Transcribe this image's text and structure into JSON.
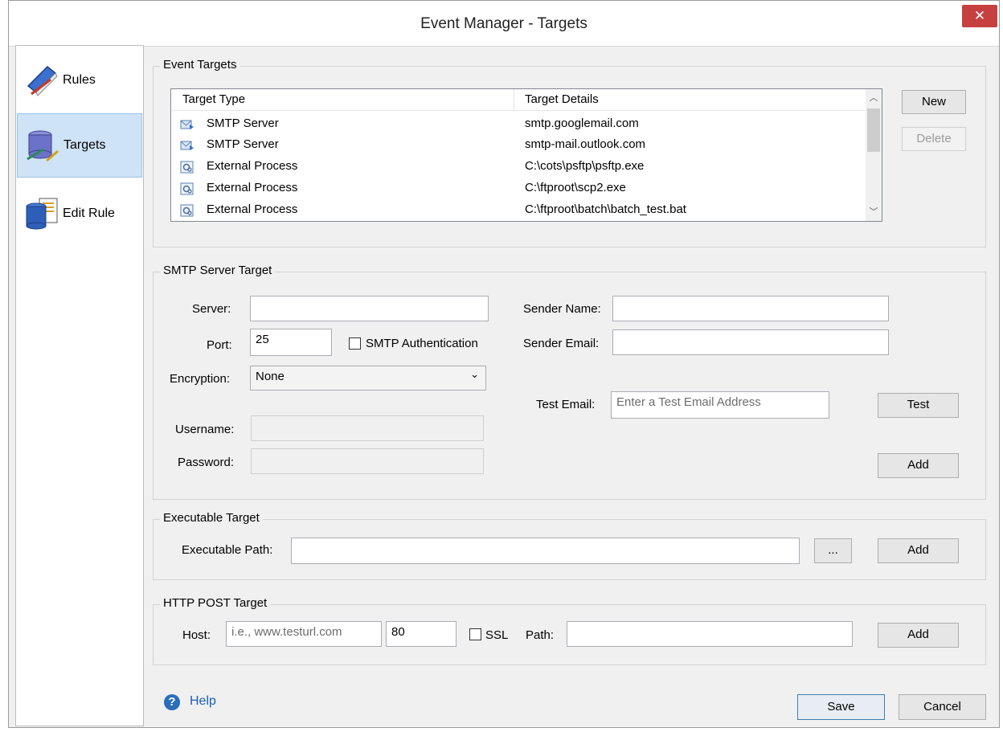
{
  "window": {
    "title": "Event Manager - Targets",
    "close_label": "✕"
  },
  "sidebar": {
    "items": [
      {
        "label": "Rules"
      },
      {
        "label": "Targets"
      },
      {
        "label": "Edit Rule"
      }
    ]
  },
  "event_targets": {
    "group_title": "Event Targets",
    "columns": [
      "Target Type",
      "Target Details"
    ],
    "rows": [
      {
        "type": "SMTP Server",
        "details": "smtp.googlemail.com",
        "icon": "mail-icon"
      },
      {
        "type": "SMTP Server",
        "details": "smtp-mail.outlook.com",
        "icon": "mail-icon"
      },
      {
        "type": "External Process",
        "details": "C:\\cots\\psftp\\psftp.exe",
        "icon": "process-icon"
      },
      {
        "type": "External Process",
        "details": "C:\\ftproot\\scp2.exe",
        "icon": "process-icon"
      },
      {
        "type": "External Process",
        "details": "C:\\ftproot\\batch\\batch_test.bat",
        "icon": "process-icon"
      }
    ],
    "new_label": "New",
    "delete_label": "Delete"
  },
  "smtp": {
    "group_title": "SMTP Server Target",
    "server_label": "Server:",
    "server_value": "",
    "port_label": "Port:",
    "port_value": "25",
    "auth_label": "SMTP Authentication",
    "encryption_label": "Encryption:",
    "encryption_value": "None",
    "username_label": "Username:",
    "password_label": "Password:",
    "sender_name_label": "Sender Name:",
    "sender_email_label": "Sender Email:",
    "test_email_label": "Test Email:",
    "test_email_placeholder": "Enter a Test Email Address",
    "test_label": "Test",
    "add_label": "Add"
  },
  "executable": {
    "group_title": "Executable Target",
    "path_label": "Executable Path:",
    "browse_label": "...",
    "add_label": "Add"
  },
  "http": {
    "group_title": "HTTP POST Target",
    "host_label": "Host:",
    "host_placeholder": "i.e., www.testurl.com",
    "port_value": "80",
    "ssl_label": "SSL",
    "path_label": "Path:",
    "add_label": "Add"
  },
  "footer": {
    "help_label": "Help",
    "save_label": "Save",
    "cancel_label": "Cancel"
  }
}
